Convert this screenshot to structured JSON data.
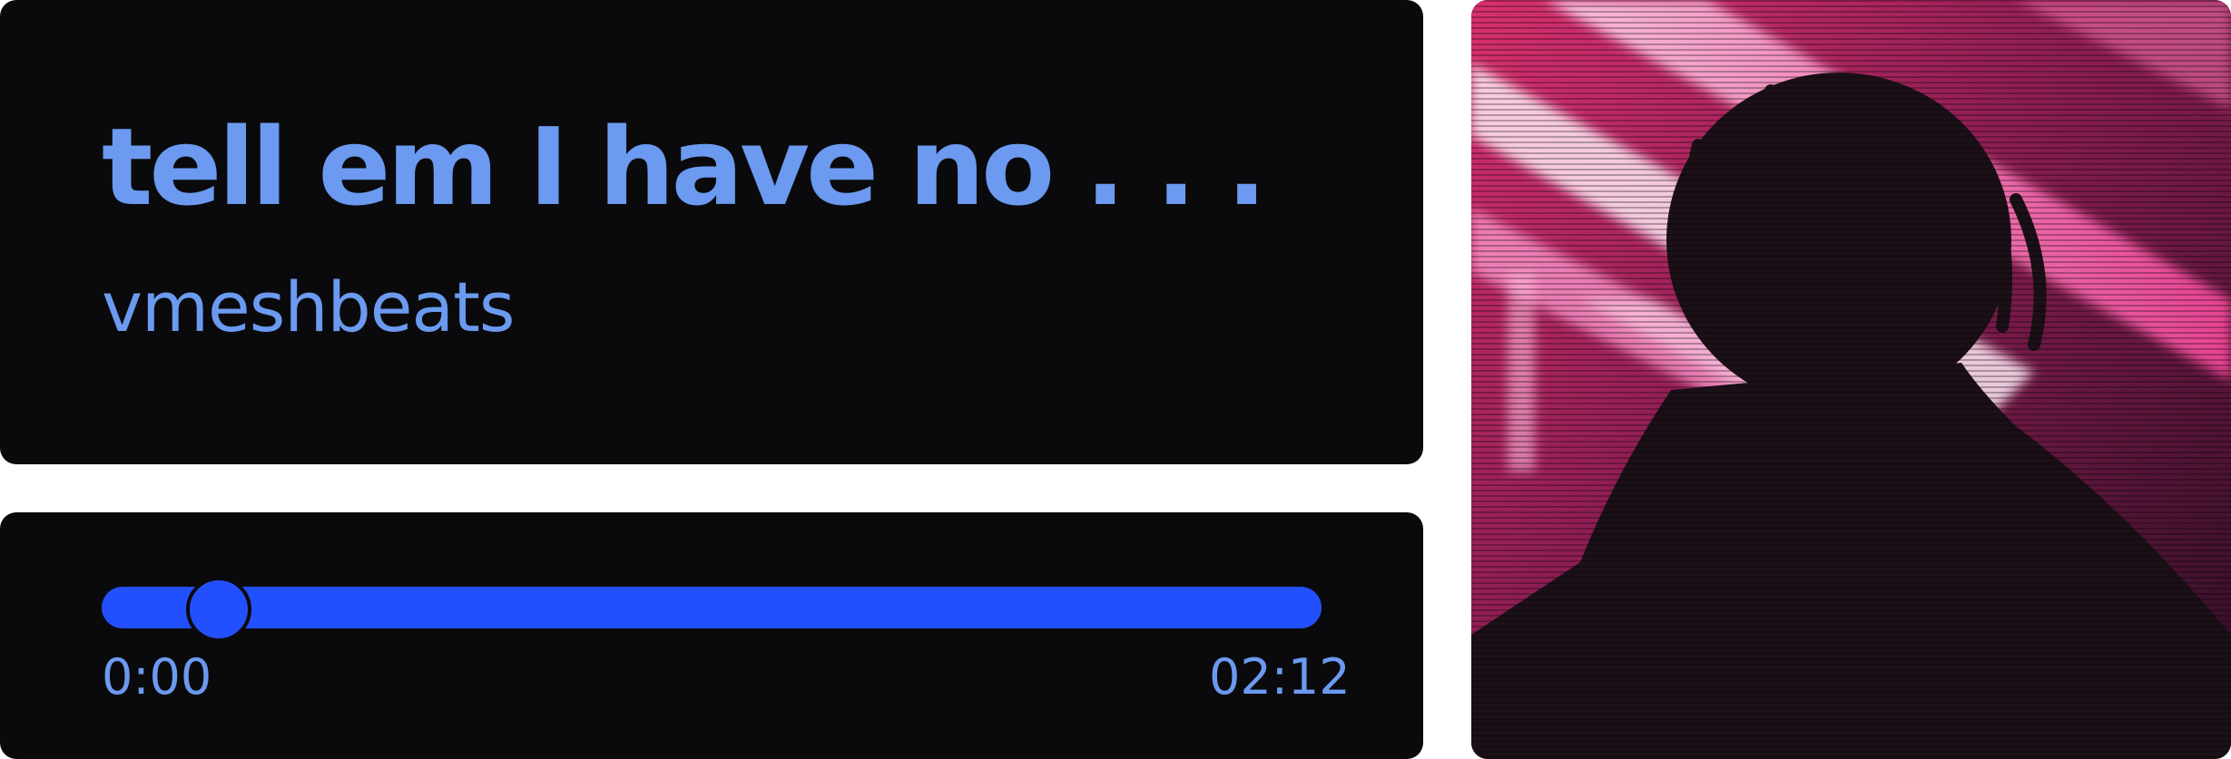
{
  "track": {
    "title": "tell em I have no . . .",
    "artist": "vmeshbeats"
  },
  "player": {
    "progress": 0.0,
    "current_time": "0:00",
    "total_time": "02:12"
  },
  "artwork": {
    "icon": "album-art-image"
  },
  "colors": {
    "text_accent": "#6b9af0",
    "progress_bar": "#2350ff",
    "card_bg": "#0a0a0c",
    "page_bg": "#ffffff"
  }
}
